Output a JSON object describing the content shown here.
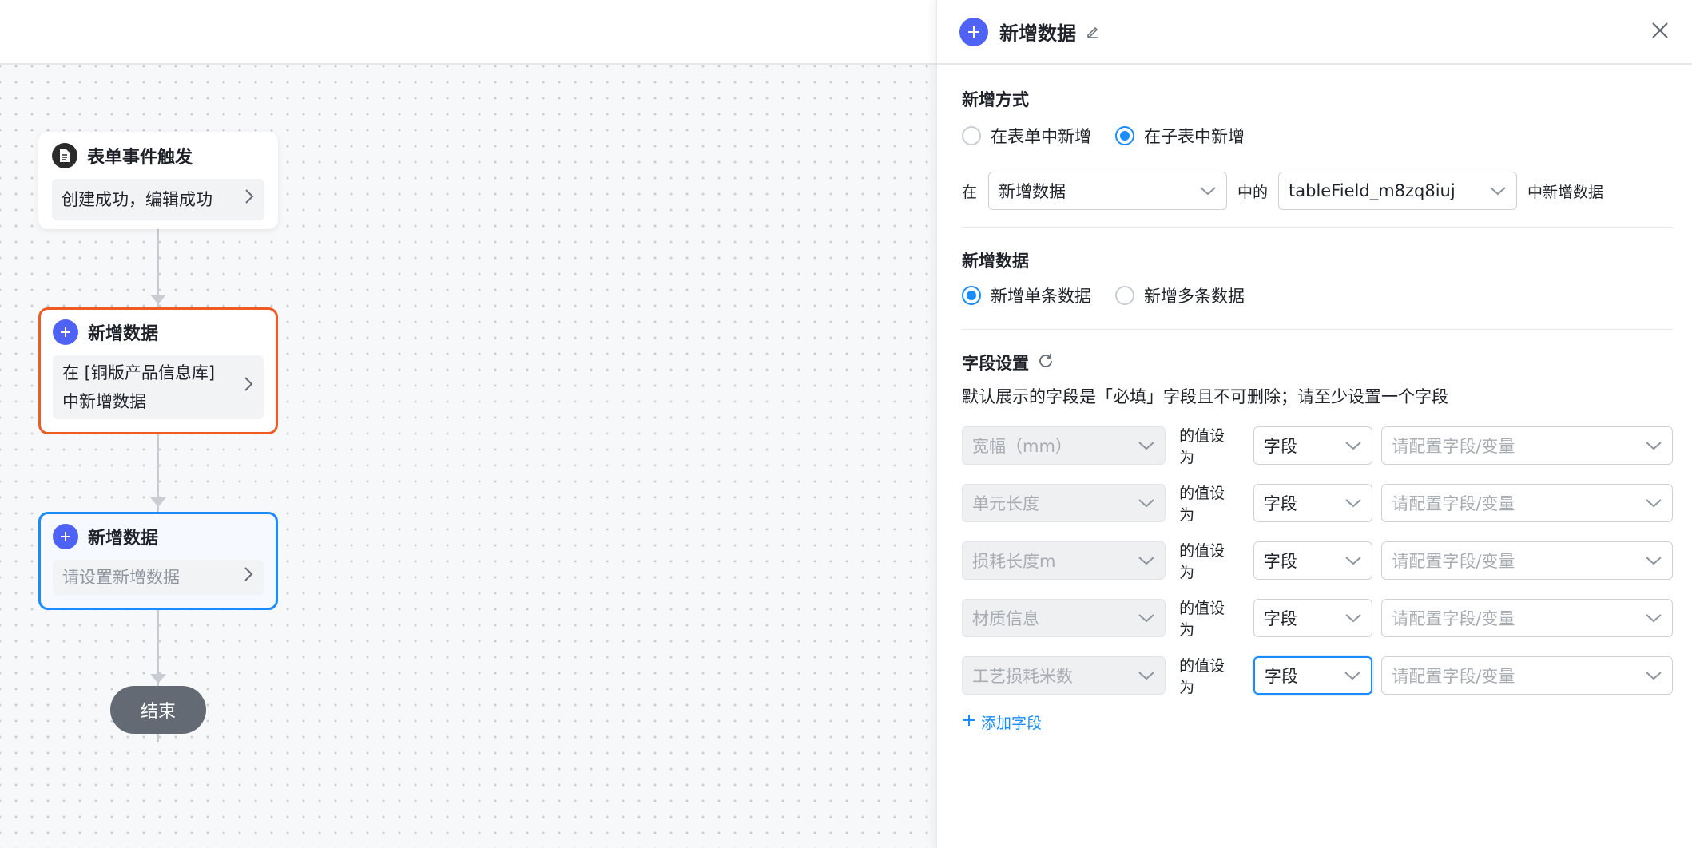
{
  "flow": {
    "trigger": {
      "title": "表单事件触发",
      "body": "创建成功，编辑成功"
    },
    "node1": {
      "title": "新增数据",
      "body": "在 [铜版产品信息库] 中新增数据"
    },
    "node2": {
      "title": "新增数据",
      "body": "请设置新增数据"
    },
    "end_label": "结束"
  },
  "panel": {
    "title": "新增数据",
    "add_method": {
      "title": "新增方式",
      "options": [
        "在表单中新增",
        "在子表中新增"
      ],
      "selected": "在子表中新增"
    },
    "location": {
      "prefix": "在",
      "form_select": "新增数据",
      "middle": "中的",
      "table_select": "tableField_m8zq8iuj",
      "suffix": "中新增数据"
    },
    "new_data": {
      "title": "新增数据",
      "options": [
        "新增单条数据",
        "新增多条数据"
      ],
      "selected": "新增单条数据"
    },
    "field_settings": {
      "title": "字段设置",
      "hint": "默认展示的字段是「必填」字段且不可删除；请至少设置一个字段",
      "value_label": "的值设为",
      "rows": [
        {
          "field": "宽幅（mm）",
          "type": "字段",
          "value_placeholder": "请配置字段/变量"
        },
        {
          "field": "单元长度",
          "type": "字段",
          "value_placeholder": "请配置字段/变量"
        },
        {
          "field": "损耗长度m",
          "type": "字段",
          "value_placeholder": "请配置字段/变量"
        },
        {
          "field": "材质信息",
          "type": "字段",
          "value_placeholder": "请配置字段/变量"
        },
        {
          "field": "工艺损耗米数",
          "type": "字段",
          "value_placeholder": "请配置字段/变量"
        }
      ],
      "add_label": "添加字段"
    }
  },
  "colors": {
    "accent": "#1a8cff",
    "node_orange": "#f05a24",
    "icon_purple": "#4e63f5",
    "end_gray": "#646a73"
  }
}
